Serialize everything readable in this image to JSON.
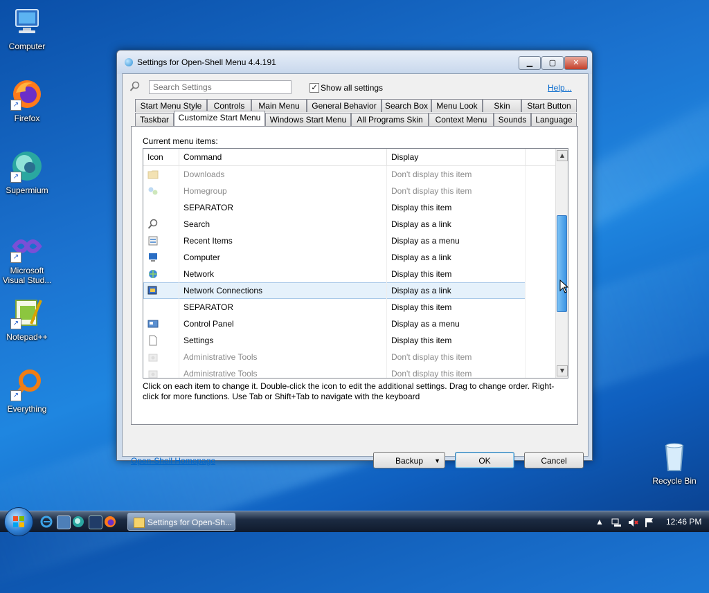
{
  "desktop": {
    "icons": [
      {
        "label": "Computer"
      },
      {
        "label": "Firefox"
      },
      {
        "label": "Supermium"
      },
      {
        "label": "Microsoft Visual Stud..."
      },
      {
        "label": "Notepad++"
      },
      {
        "label": "Everything"
      },
      {
        "label": "Recycle Bin"
      }
    ]
  },
  "window": {
    "title": "Settings for Open-Shell Menu 4.4.191",
    "search_placeholder": "Search Settings",
    "show_all_label": "Show all settings",
    "show_all_checked": true,
    "help_label": "Help...",
    "tabs_row1": [
      "Start Menu Style",
      "Controls",
      "Main Menu",
      "General Behavior",
      "Search Box",
      "Menu Look",
      "Skin",
      "Start Button"
    ],
    "tabs_row2": [
      "Taskbar",
      "Customize Start Menu",
      "Windows Start Menu",
      "All Programs Skin",
      "Context Menu",
      "Sounds",
      "Language"
    ],
    "active_tab": "Customize Start Menu",
    "current_items_label": "Current menu items:",
    "columns": [
      "Icon",
      "Command",
      "Display"
    ],
    "rows": [
      {
        "icon": "folder-icon",
        "command": "Downloads",
        "display": "Don't display this item",
        "dim": true
      },
      {
        "icon": "homegroup-icon",
        "command": "Homegroup",
        "display": "Don't display this item",
        "dim": true
      },
      {
        "icon": "",
        "command": "SEPARATOR",
        "display": "Display this item",
        "dim": false
      },
      {
        "icon": "search-icon",
        "command": "Search",
        "display": "Display as a link",
        "dim": false
      },
      {
        "icon": "recent-items-icon",
        "command": "Recent Items",
        "display": "Display as a menu",
        "dim": false
      },
      {
        "icon": "computer-icon",
        "command": "Computer",
        "display": "Display as a link",
        "dim": false
      },
      {
        "icon": "network-icon",
        "command": "Network",
        "display": "Display this item",
        "dim": false
      },
      {
        "icon": "network-connections-icon",
        "command": "Network Connections",
        "display": "Display as a link",
        "dim": false,
        "selected": true
      },
      {
        "icon": "",
        "command": "SEPARATOR",
        "display": "Display this item",
        "dim": false
      },
      {
        "icon": "control-panel-icon",
        "command": "Control Panel",
        "display": "Display as a menu",
        "dim": false
      },
      {
        "icon": "document-icon",
        "command": "Settings",
        "display": "Display this item",
        "dim": false
      },
      {
        "icon": "admin-tools-icon",
        "command": "Administrative Tools",
        "display": "Don't display this item",
        "dim": true
      },
      {
        "icon": "admin-tools-icon",
        "command": "Administrative Tools",
        "display": "Don't display this item",
        "dim": true
      }
    ],
    "hint": "Click on each item to change it. Double-click the icon to edit the additional settings. Drag to change order. Right-click for more functions. Use Tab or Shift+Tab to navigate with the keyboard",
    "homepage_link": "Open-Shell Homepage",
    "backup_label": "Backup",
    "ok_label": "OK",
    "cancel_label": "Cancel"
  },
  "taskbar": {
    "task_label": "Settings for Open-Sh...",
    "clock": "12:46 PM"
  },
  "colors": {
    "accent": "#0066cc",
    "selection": "#e5f1fb",
    "desktop": "#1b72cf"
  }
}
